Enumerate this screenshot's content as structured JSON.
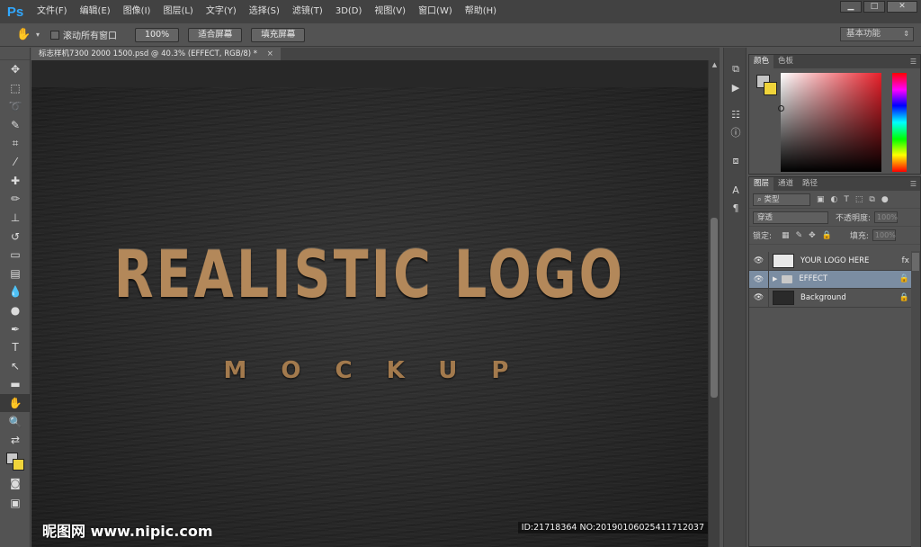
{
  "app": {
    "logo": "Ps"
  },
  "menu": [
    "文件(F)",
    "编辑(E)",
    "图像(I)",
    "图层(L)",
    "文字(Y)",
    "选择(S)",
    "滤镜(T)",
    "3D(D)",
    "视图(V)",
    "窗口(W)",
    "帮助(H)"
  ],
  "window_buttons": {
    "minimize": "▁",
    "restore": "□",
    "close": "✕"
  },
  "options": {
    "scroll_all_label": "滚动所有窗口",
    "zoom_100": "100%",
    "fit_screen": "适合屏幕",
    "fill_screen": "填充屏幕",
    "workspace": "基本功能"
  },
  "doc_tab": {
    "title": "标志样机7300 2000 1500.psd @ 40.3% (EFFECT, RGB/8) *",
    "close": "×"
  },
  "canvas": {
    "logo_main": "REALISTIC LOGO",
    "logo_sub": "MOCKUP",
    "watermark": "昵图网 www.nipic.com",
    "watermark_id": "ID:21718364 NO:20190106025411712037"
  },
  "color_panel": {
    "tabs": [
      "颜色",
      "色板"
    ],
    "fg": "#c4c4c4",
    "bg": "#f0d43a"
  },
  "layers_panel": {
    "tabs": [
      "图层",
      "通道",
      "路径"
    ],
    "filter": "类型",
    "blend_mode": "穿透",
    "opacity_label": "不透明度:",
    "opacity_value": "100%",
    "lock_label": "锁定:",
    "fill_label": "填充:",
    "fill_value": "100%",
    "layers": [
      {
        "name": "YOUR LOGO HERE",
        "badge": "fx"
      },
      {
        "name": "EFFECT",
        "badge": "🔒"
      },
      {
        "name": "Background",
        "badge": "🔒"
      }
    ]
  },
  "colors": {
    "selection": "#7b8da2",
    "accent": "#31a8ff",
    "logo_gold": "#b3885a"
  }
}
